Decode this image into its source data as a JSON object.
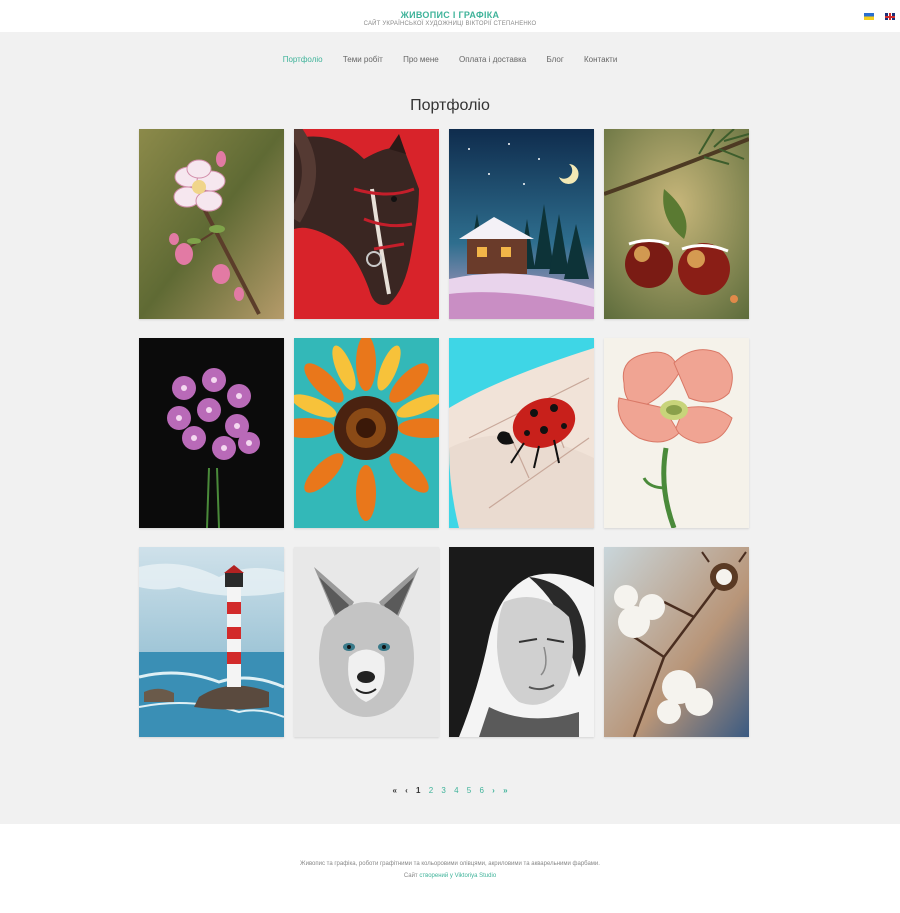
{
  "header": {
    "title": "ЖИВОПИС І ГРАФІКА",
    "subtitle": "САЙТ УКРАЇНСЬКОЇ ХУДОЖНИЦІ ВІКТОРІЇ СТЕПАНЕНКО",
    "languages": [
      "uk",
      "en"
    ]
  },
  "nav": {
    "items": [
      "Портфоліо",
      "Теми робіт",
      "Про мене",
      "Оплата і доставка",
      "Блог",
      "Контакти"
    ],
    "active_index": 0
  },
  "main": {
    "heading": "Портфоліо",
    "artworks": [
      {
        "subject": "blossom branch"
      },
      {
        "subject": "horse"
      },
      {
        "subject": "winter cabin"
      },
      {
        "subject": "christmas ornaments"
      },
      {
        "subject": "phlox flowers"
      },
      {
        "subject": "sunflower"
      },
      {
        "subject": "ladybug"
      },
      {
        "subject": "poppy"
      },
      {
        "subject": "lighthouse"
      },
      {
        "subject": "wolf pup"
      },
      {
        "subject": "portrait"
      },
      {
        "subject": "cotton branch"
      }
    ]
  },
  "pagination": {
    "first": "«",
    "prev": "‹",
    "pages": [
      "1",
      "2",
      "3",
      "4",
      "5",
      "6"
    ],
    "current": "1",
    "next": "›",
    "last": "»"
  },
  "footer": {
    "text": "Живопис та графіка, роботи графітними та кольоровими олівцями, акриловими та акварельними фарбами.",
    "credit_prefix": "Сайт ",
    "credit_link": "створений у Viktoriya Studio"
  },
  "colors": {
    "accent": "#3fb39a",
    "background": "#f1f1f1"
  }
}
